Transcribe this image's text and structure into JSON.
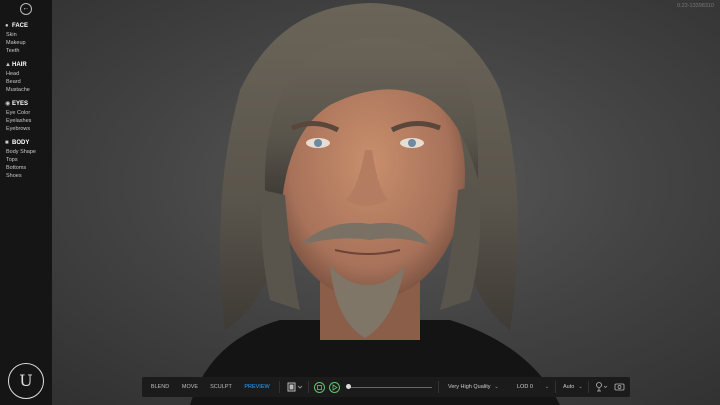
{
  "version": "0.23-13398310",
  "sidebar": {
    "back_icon": "arrow-left-icon",
    "sections": [
      {
        "title": "FACE",
        "icon": "face-icon",
        "items": [
          "Skin",
          "Makeup",
          "Teeth"
        ]
      },
      {
        "title": "HAIR",
        "icon": "hair-icon",
        "items": [
          "Head",
          "Beard",
          "Mustache"
        ]
      },
      {
        "title": "EYES",
        "icon": "eye-icon",
        "items": [
          "Eye Color",
          "Eyelashes",
          "Eyebrows"
        ]
      },
      {
        "title": "BODY",
        "icon": "body-icon",
        "items": [
          "Body Shape",
          "Tops",
          "Bottoms",
          "Shoes"
        ]
      }
    ],
    "logo": "unreal-engine-logo"
  },
  "toolbar": {
    "modes": [
      "BLEND",
      "MOVE",
      "SCULPT",
      "PREVIEW"
    ],
    "active_mode": "PREVIEW",
    "quality": "Very High Quality",
    "lod": "LOD 0",
    "auto": "Auto",
    "icons": [
      "film-icon",
      "stop-icon",
      "play-icon",
      "light-icon",
      "camera-icon"
    ]
  },
  "colors": {
    "accent": "#2fa3ff",
    "play": "#5ec46e",
    "sidebar": "#151515"
  }
}
